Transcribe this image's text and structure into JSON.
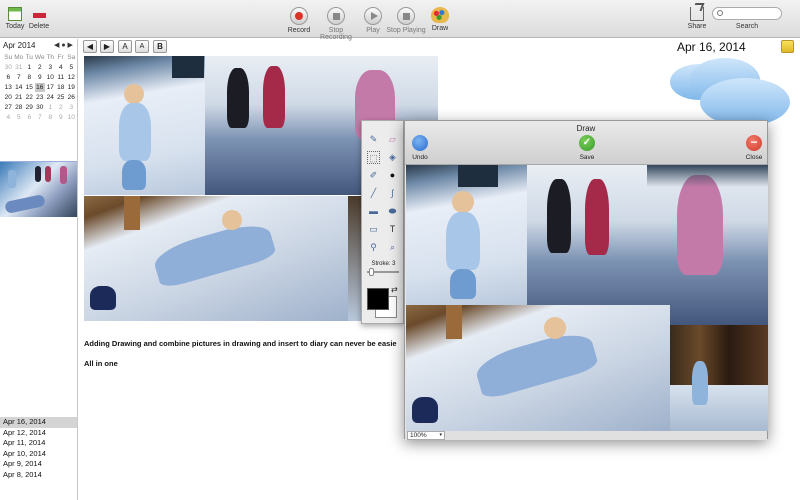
{
  "toolbar": {
    "today_label": "Today",
    "delete_label": "Delete",
    "record_label": "Record",
    "stop_recording_label": "Stop Recording",
    "play_label": "Play",
    "stop_playing_label": "Stop Playing",
    "draw_label": "Draw",
    "share_label": "Share",
    "search_label": "Search",
    "search_placeholder": ""
  },
  "calendar": {
    "month_label": "Apr 2014",
    "nav": [
      "◀",
      "●",
      "▶"
    ],
    "weekdays": [
      "Su",
      "Mo",
      "Tu",
      "We",
      "Th",
      "Fr",
      "Sa"
    ],
    "weeks": [
      [
        "30",
        "31",
        "1",
        "2",
        "3",
        "4",
        "5"
      ],
      [
        "6",
        "7",
        "8",
        "9",
        "10",
        "11",
        "12"
      ],
      [
        "13",
        "14",
        "15",
        "16",
        "17",
        "18",
        "19"
      ],
      [
        "20",
        "21",
        "22",
        "23",
        "24",
        "25",
        "26"
      ],
      [
        "27",
        "28",
        "29",
        "30",
        "1",
        "2",
        "3"
      ],
      [
        "4",
        "5",
        "6",
        "7",
        "8",
        "9",
        "10"
      ]
    ]
  },
  "entries": [
    "Apr 16, 2014",
    "Apr 12, 2014",
    "Apr 11, 2014",
    "Apr 10, 2014",
    "Apr 9, 2014",
    "Apr 8, 2014"
  ],
  "format_toolbar": {
    "back": "◀",
    "forward": "▶",
    "font_larger": "A",
    "font_smaller": "A",
    "bold": "B"
  },
  "diary": {
    "date_title": "Apr 16, 2014",
    "line1": "Adding Drawing and combine pictures in drawing and insert to diary can never be easie",
    "line2": "All in one"
  },
  "palette": {
    "stroke_label": "Stroke: 3",
    "text_tool": "T"
  },
  "draw_window": {
    "title": "Draw",
    "undo_label": "Undo",
    "save_label": "Save",
    "close_label": "Close",
    "zoom_value": "100%"
  },
  "colors": {
    "accent_green": "#3a9a2a",
    "close_red": "#d23a2a",
    "undo_blue": "#2a6ad0"
  }
}
